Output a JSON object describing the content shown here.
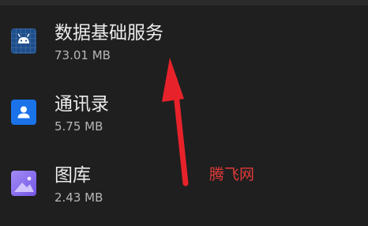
{
  "apps": [
    {
      "name": "数据基础服务",
      "size": "73.01 MB",
      "icon": "android-icon"
    },
    {
      "name": "通讯录",
      "size": "5.75 MB",
      "icon": "contacts-icon"
    },
    {
      "name": "图库",
      "size": "2.43 MB",
      "icon": "gallery-icon"
    }
  ],
  "annotation": {
    "watermark": "腾飞网",
    "arrow_color": "#e8222a"
  },
  "colors": {
    "background": "#1f1f1f",
    "contacts_blue": "#1a73e8",
    "gallery_purple": "#8a6ff0"
  }
}
